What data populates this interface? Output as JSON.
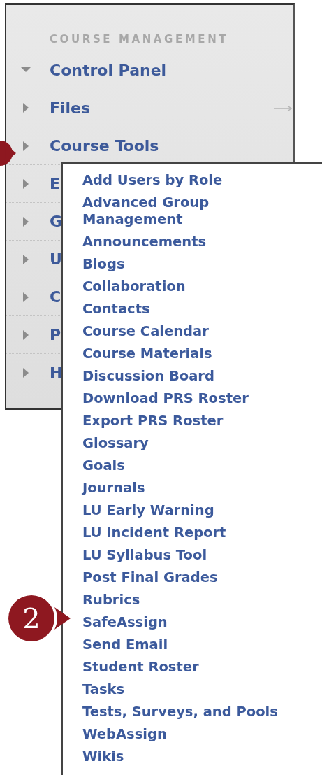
{
  "panel": {
    "heading": "COURSE MANAGEMENT",
    "items": [
      {
        "label": "Control Panel",
        "expanded": true
      },
      {
        "label": "Files",
        "expanded": false,
        "trailing_arrow": true
      },
      {
        "label": "Course Tools",
        "expanded": false
      },
      {
        "label": "E",
        "expanded": false
      },
      {
        "label": "G",
        "expanded": false
      },
      {
        "label": "U",
        "expanded": false
      },
      {
        "label": "C",
        "expanded": false
      },
      {
        "label": "P",
        "expanded": false
      },
      {
        "label": "H",
        "expanded": false
      }
    ]
  },
  "menu": {
    "items": [
      {
        "lines": [
          "Add Users by Role"
        ]
      },
      {
        "lines": [
          "Advanced Group",
          "Management"
        ]
      },
      {
        "lines": [
          "Announcements"
        ]
      },
      {
        "lines": [
          "Blogs"
        ]
      },
      {
        "lines": [
          "Collaboration"
        ]
      },
      {
        "lines": [
          "Contacts"
        ]
      },
      {
        "lines": [
          "Course Calendar"
        ]
      },
      {
        "lines": [
          "Course Materials"
        ]
      },
      {
        "lines": [
          "Discussion Board"
        ]
      },
      {
        "lines": [
          "Download PRS Roster"
        ]
      },
      {
        "lines": [
          "Export PRS Roster"
        ]
      },
      {
        "lines": [
          "Glossary"
        ]
      },
      {
        "lines": [
          "Goals"
        ]
      },
      {
        "lines": [
          "Journals"
        ]
      },
      {
        "lines": [
          "LU Early Warning"
        ]
      },
      {
        "lines": [
          "LU Incident Report"
        ]
      },
      {
        "lines": [
          "LU Syllabus Tool"
        ]
      },
      {
        "lines": [
          "Post Final Grades"
        ]
      },
      {
        "lines": [
          "Rubrics"
        ]
      },
      {
        "lines": [
          "SafeAssign"
        ]
      },
      {
        "lines": [
          "Send Email"
        ]
      },
      {
        "lines": [
          "Student Roster"
        ]
      },
      {
        "lines": [
          "Tasks"
        ]
      },
      {
        "lines": [
          "Tests, Surveys, and Pools"
        ]
      },
      {
        "lines": [
          "WebAssign"
        ]
      },
      {
        "lines": [
          "Wikis"
        ]
      }
    ]
  },
  "callouts": [
    {
      "kind": "cut"
    },
    {
      "kind": "numbered",
      "label": "2"
    }
  ]
}
